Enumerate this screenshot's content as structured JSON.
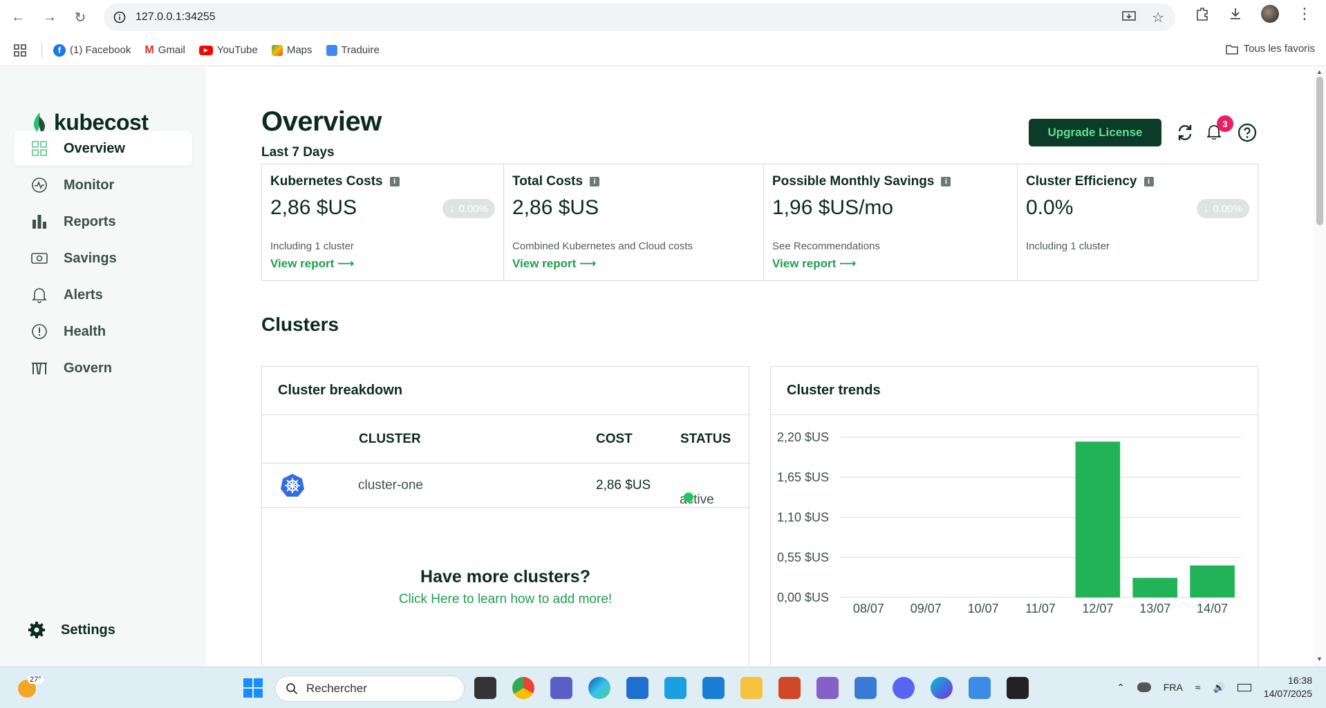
{
  "browser": {
    "url": "127.0.0.1:34255",
    "bookmarks": [
      "(1) Facebook",
      "Gmail",
      "YouTube",
      "Maps",
      "Traduire"
    ],
    "all_bookmarks": "Tous les favoris"
  },
  "app": {
    "brand": "kubecost",
    "nav": [
      {
        "label": "Overview",
        "active": true
      },
      {
        "label": "Monitor"
      },
      {
        "label": "Reports"
      },
      {
        "label": "Savings"
      },
      {
        "label": "Alerts"
      },
      {
        "label": "Health"
      },
      {
        "label": "Govern"
      }
    ],
    "settings": "Settings"
  },
  "header": {
    "title": "Overview",
    "period": "Last 7 Days",
    "upgrade_label": "Upgrade License",
    "notification_count": "3"
  },
  "cards": [
    {
      "title": "Kubernetes Costs",
      "value": "2,86 $US",
      "change": "0.00%",
      "note": "Including 1 cluster",
      "link": "View report"
    },
    {
      "title": "Total Costs",
      "value": "2,86 $US",
      "note": "Combined Kubernetes and Cloud costs",
      "link": "View report"
    },
    {
      "title": "Possible Monthly Savings",
      "value": "1,96 $US/mo",
      "note": "See Recommendations",
      "link": "View report"
    },
    {
      "title": "Cluster Efficiency",
      "value": "0.0%",
      "change": "0.00%",
      "note": "Including 1 cluster"
    }
  ],
  "clusters": {
    "section_title": "Clusters",
    "breakdown": {
      "title": "Cluster breakdown",
      "columns": [
        "CLUSTER",
        "COST",
        "STATUS"
      ],
      "rows": [
        {
          "cluster": "cluster-one",
          "cost": "2,86 $US",
          "status": "active"
        }
      ],
      "more_title": "Have more clusters?",
      "more_link": "Click Here to learn how to add more!"
    },
    "trends_title": "Cluster trends"
  },
  "chart_data": {
    "type": "bar",
    "categories": [
      "08/07",
      "09/07",
      "10/07",
      "11/07",
      "12/07",
      "13/07",
      "14/07"
    ],
    "values": [
      0,
      0,
      0,
      0,
      2.14,
      0.27,
      0.44
    ],
    "yticks": [
      "0,00 $US",
      "0,55 $US",
      "1,10 $US",
      "1,65 $US",
      "2,20 $US"
    ],
    "ylim": [
      0,
      2.2
    ],
    "grid": true,
    "color": "#22b359"
  },
  "taskbar": {
    "weather": "27°",
    "search_placeholder": "Rechercher",
    "lang": "FRA",
    "time": "16:38",
    "date": "14/07/2025"
  }
}
